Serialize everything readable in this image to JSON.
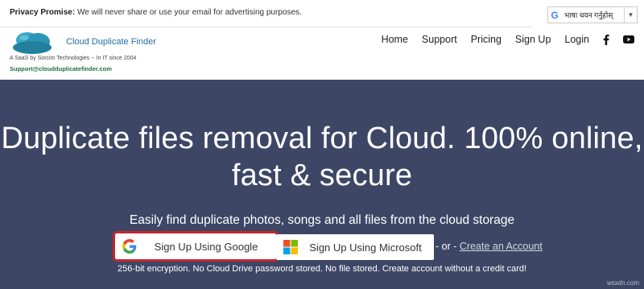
{
  "topbar": {
    "privacy_label": "Privacy Promise:",
    "privacy_text": " We will never share or use your email for advertising purposes."
  },
  "language_selector": {
    "icon": "google-g-icon",
    "value": "भाषा चयन गर्नुहोस्",
    "arrow": "▼"
  },
  "brand": {
    "name": "Cloud Duplicate Finder",
    "tagline": "A SaaS by Sorcim Technologies -- In IT since 2004",
    "email": "Support@cloudduplicatefinder.com",
    "logo_color": "#2a96b8"
  },
  "nav": {
    "items": [
      "Home",
      "Support",
      "Pricing",
      "Sign Up",
      "Login"
    ],
    "icons": [
      "facebook-icon",
      "youtube-icon"
    ]
  },
  "hero": {
    "background": "#3d4665",
    "headline": "Duplicate files removal for Cloud. 100% online, fast & secure",
    "subheadline": "Easily find duplicate photos, songs and all files from the cloud storage",
    "google_button": "Sign Up Using Google",
    "microsoft_button": "Sign Up Using Microsoft",
    "or_text": "- or -",
    "create_account": "Create an Account",
    "note": "256-bit encryption. No Cloud Drive password stored. No file stored. Create account without a credit card!",
    "highlight_color": "#c4262e"
  },
  "watermark": "wsxdn.com"
}
